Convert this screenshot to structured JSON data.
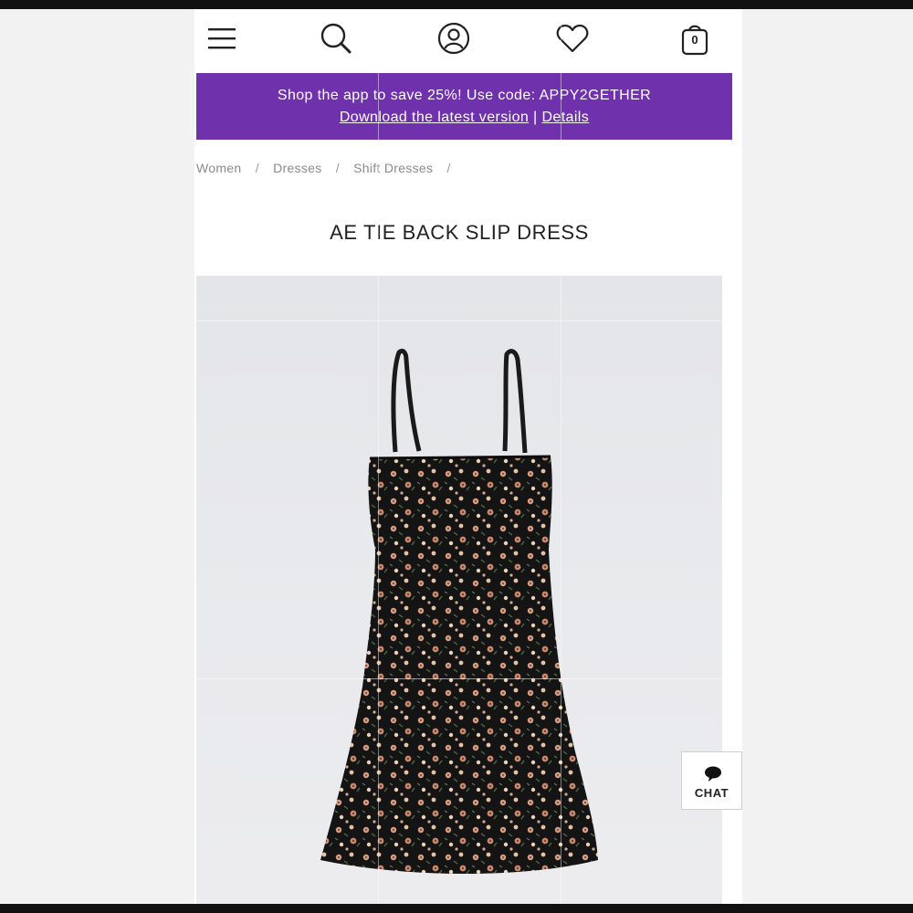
{
  "header": {
    "icons": [
      "menu-icon",
      "search-icon",
      "account-icon",
      "heart-icon",
      "bag-icon"
    ],
    "cart_count": "0"
  },
  "promo": {
    "message": "Shop the app to save 25%! Use code: APPY2GETHER",
    "download_link": "Download the latest version",
    "separator": "|",
    "details_link": "Details",
    "background": "#7031ad"
  },
  "breadcrumb": {
    "items": [
      "Women",
      "Dresses",
      "Shift Dresses"
    ],
    "separator": "/"
  },
  "product": {
    "title": "AE TIE BACK SLIP DRESS"
  },
  "chat": {
    "label": "CHAT"
  }
}
